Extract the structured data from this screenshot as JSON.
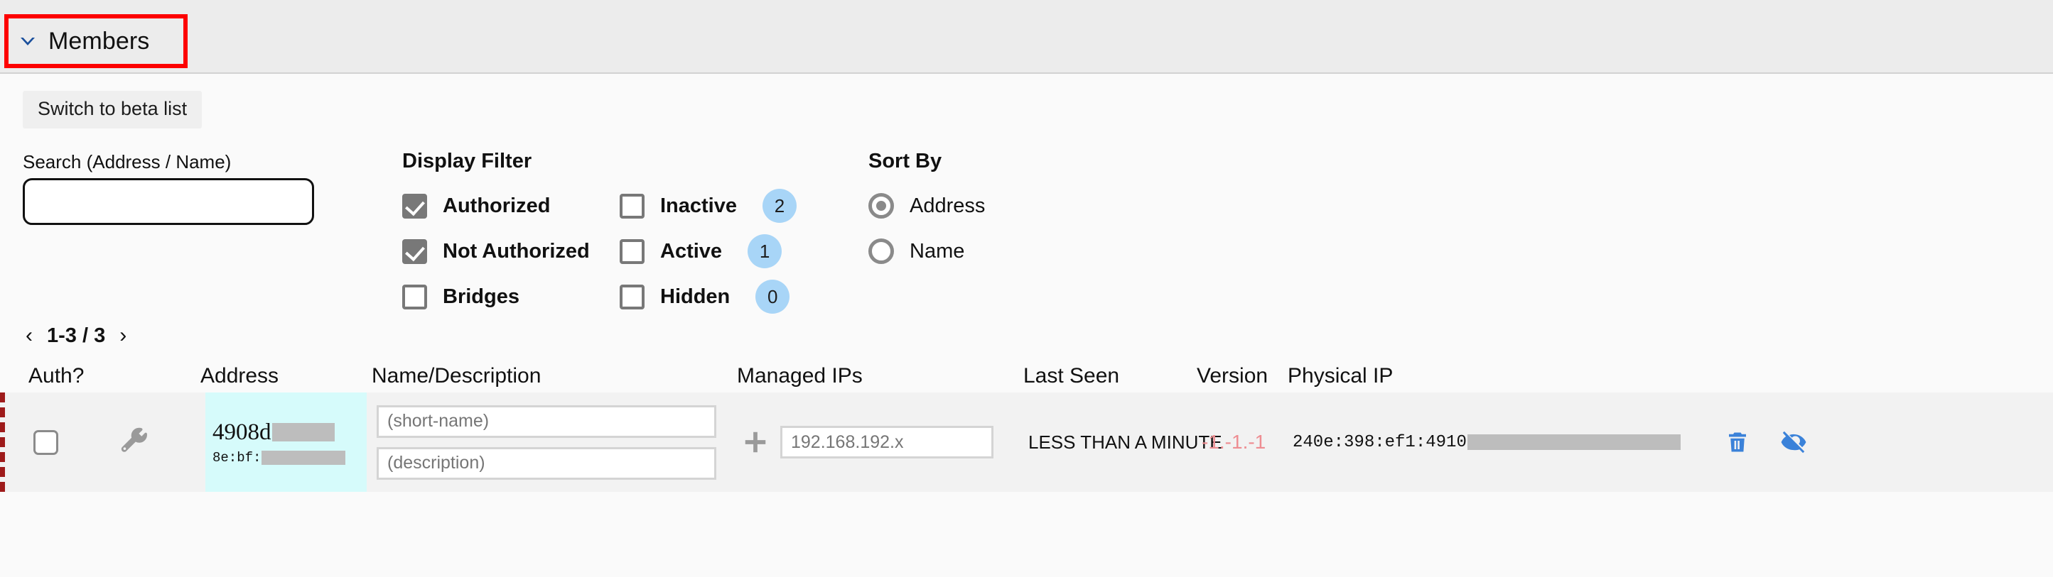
{
  "header": {
    "section_label": "Members",
    "chevron_icon": "chevron-down-icon",
    "annotation_color": "#fd0000",
    "chevron_color": "#1a4f9c"
  },
  "toolbar": {
    "beta_button": "Switch to beta list"
  },
  "search": {
    "label": "Search (Address / Name)",
    "value": "",
    "placeholder": ""
  },
  "display_filter": {
    "title": "Display Filter",
    "column1": [
      {
        "label": "Authorized",
        "checked": true
      },
      {
        "label": "Not Authorized",
        "checked": true
      },
      {
        "label": "Bridges",
        "checked": false
      }
    ],
    "column2": [
      {
        "label": "Inactive",
        "checked": false,
        "badge": "2"
      },
      {
        "label": "Active",
        "checked": false,
        "badge": "1"
      },
      {
        "label": "Hidden",
        "checked": false,
        "badge": "0"
      }
    ],
    "badge_color": "#a8d5f7"
  },
  "sort_by": {
    "title": "Sort By",
    "options": [
      {
        "label": "Address",
        "selected": true
      },
      {
        "label": "Name",
        "selected": false
      }
    ]
  },
  "pagination": {
    "prev_icon": "chevron-left-icon",
    "next_icon": "chevron-right-icon",
    "range": "1-3 / 3"
  },
  "table": {
    "headers": {
      "auth": "Auth?",
      "address": "Address",
      "name": "Name/Description",
      "managed_ips": "Managed IPs",
      "last_seen": "Last Seen",
      "version": "Version",
      "physical_ip": "Physical IP"
    },
    "rows": [
      {
        "auth_checked": false,
        "wrench_icon": "wrench-icon",
        "address_main": "4908d",
        "address_sub": "8e:bf:",
        "short_name_value": "",
        "short_name_placeholder": "(short-name)",
        "description_value": "",
        "description_placeholder": "(description)",
        "add_ip_icon": "plus-icon",
        "managed_ip_value": "",
        "managed_ip_placeholder": "192.168.192.x",
        "last_seen": "LESS THAN A MINUTE",
        "version": "-1.-1.-1",
        "version_color": "#ee8d92",
        "physical_ip": "240e:398:ef1:4910",
        "delete_icon": "trash-icon",
        "hide_icon": "eye-slash-icon",
        "action_icon_color": "#3b82d9",
        "address_cell_color": "#d6fbfb",
        "row_marker_color": "#9e1b1b"
      }
    ]
  }
}
